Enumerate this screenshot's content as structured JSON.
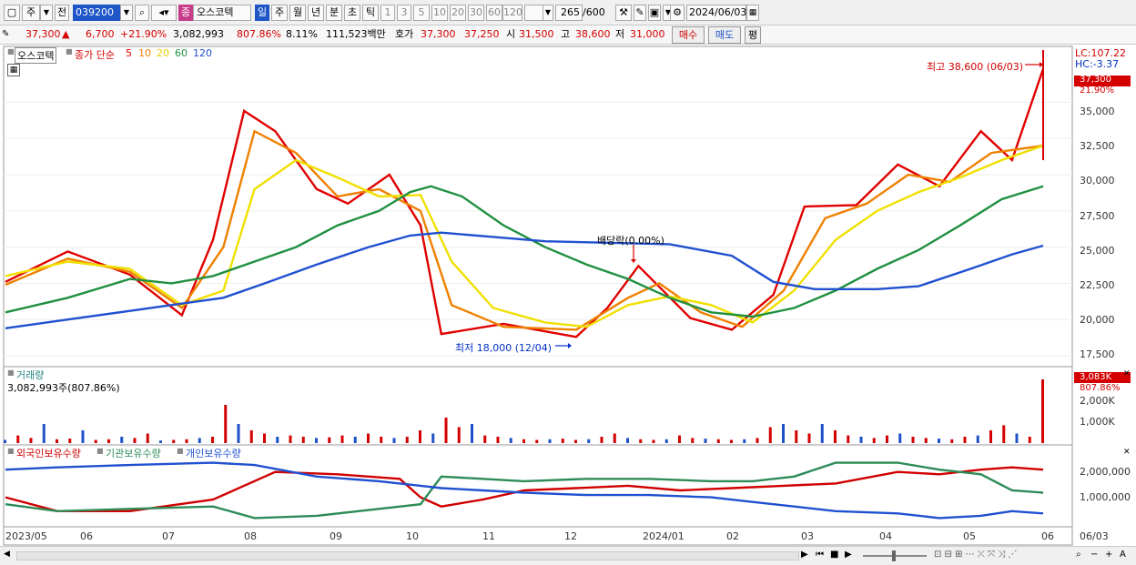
{
  "toolbar": {
    "period_main": "주",
    "prev_label": "전",
    "code": "039200",
    "stock_badge": "종",
    "stock_name": "오스코텍",
    "intervals": [
      "일",
      "주",
      "월",
      "년",
      "분",
      "초",
      "틱"
    ],
    "active_interval": "일",
    "minute_options": [
      "1",
      "3",
      "5",
      "10",
      "20",
      "30",
      "60",
      "120"
    ],
    "count": "265",
    "count_max": "/600",
    "date": "2024/06/03"
  },
  "quote": {
    "price": "37,300",
    "change_arrow": "▲",
    "change": "6,700",
    "change_pct": "+21.90%",
    "volume": "3,082,993",
    "volume_ratio": "807.86%",
    "turnover": "8.11%",
    "amount": "111,523백만",
    "ask_label": "호가",
    "ask": "37,300",
    "bid": "37,250",
    "open_label": "시",
    "open": "31,500",
    "high_label": "고",
    "high": "38,600",
    "low_label": "저",
    "low": "31,000",
    "buy_label": "매수",
    "sell_label": "매도",
    "eval_label": "평"
  },
  "price_panel": {
    "name_tab": "오스코텍",
    "legend_prefix": "종가 단순",
    "ma": [
      {
        "label": "5",
        "color": "#e00000"
      },
      {
        "label": "10",
        "color": "#f08000"
      },
      {
        "label": "20",
        "color": "#f0e000"
      },
      {
        "label": "60",
        "color": "#209040"
      },
      {
        "label": "120",
        "color": "#2050d0"
      }
    ],
    "lc": "LC:107.22",
    "hc": "HC:-3.37",
    "last_price": "37,300",
    "last_pct": "21.90%",
    "high_annotation": "최고 38,600 (06/03)",
    "low_annotation": "최저 18,000 (12/04)",
    "dividend_annotation": "배당락(0.00%)",
    "yticks": [
      "35,000",
      "32,500",
      "30,000",
      "27,500",
      "25,000",
      "22,500",
      "20,000",
      "17,500"
    ]
  },
  "volume_panel": {
    "title": "거래량",
    "summary": "3,082,993주(807.86%)",
    "last_value": "3,083K",
    "last_pct": "807.86%",
    "yticks": [
      "2,000K",
      "1,000K"
    ]
  },
  "holdings_panel": {
    "legend": [
      {
        "label": "외국인보유수량",
        "color": "#d00000"
      },
      {
        "label": "기관보유수량",
        "color": "#2e8b57"
      },
      {
        "label": "개인보유수량",
        "color": "#2050d0"
      }
    ],
    "yticks": [
      "2,000,000",
      "1,000,000"
    ]
  },
  "xaxis": {
    "labels": [
      "2023/05",
      "06",
      "07",
      "08",
      "09",
      "10",
      "11",
      "12",
      "2024/01",
      "02",
      "03",
      "04",
      "05",
      "06"
    ],
    "right_label": "06/03"
  },
  "colors": {
    "up": "#d40000",
    "down": "#1e50c8",
    "accent": "#1e56c8"
  },
  "chart_data": {
    "type": "line",
    "title": "",
    "series": [
      {
        "name": "5",
        "color": "#e00000",
        "points": [
          [
            0,
            22600
          ],
          [
            0.06,
            24700
          ],
          [
            0.12,
            23100
          ],
          [
            0.17,
            20300
          ],
          [
            0.2,
            25500
          ],
          [
            0.23,
            34400
          ],
          [
            0.26,
            33000
          ],
          [
            0.3,
            29000
          ],
          [
            0.33,
            28000
          ],
          [
            0.37,
            30000
          ],
          [
            0.4,
            26500
          ],
          [
            0.42,
            19000
          ],
          [
            0.48,
            19700
          ],
          [
            0.55,
            18800
          ],
          [
            0.58,
            20800
          ],
          [
            0.61,
            23700
          ],
          [
            0.66,
            20100
          ],
          [
            0.7,
            19300
          ],
          [
            0.74,
            21700
          ],
          [
            0.77,
            27800
          ],
          [
            0.82,
            27900
          ],
          [
            0.86,
            30700
          ],
          [
            0.9,
            29200
          ],
          [
            0.94,
            33000
          ],
          [
            0.97,
            31000
          ],
          [
            1,
            37300
          ]
        ]
      },
      {
        "name": "10",
        "color": "#f08000",
        "points": [
          [
            0,
            22400
          ],
          [
            0.06,
            24200
          ],
          [
            0.12,
            23300
          ],
          [
            0.17,
            20800
          ],
          [
            0.21,
            25000
          ],
          [
            0.24,
            33000
          ],
          [
            0.28,
            31500
          ],
          [
            0.32,
            28500
          ],
          [
            0.36,
            29000
          ],
          [
            0.4,
            27500
          ],
          [
            0.43,
            21000
          ],
          [
            0.48,
            19500
          ],
          [
            0.55,
            19300
          ],
          [
            0.6,
            21500
          ],
          [
            0.63,
            22500
          ],
          [
            0.67,
            20500
          ],
          [
            0.71,
            19500
          ],
          [
            0.75,
            22000
          ],
          [
            0.79,
            27000
          ],
          [
            0.83,
            28000
          ],
          [
            0.87,
            30000
          ],
          [
            0.91,
            29500
          ],
          [
            0.95,
            31500
          ],
          [
            1,
            32000
          ]
        ]
      },
      {
        "name": "20",
        "color": "#f0e000",
        "points": [
          [
            0,
            23000
          ],
          [
            0.06,
            24000
          ],
          [
            0.12,
            23500
          ],
          [
            0.17,
            21000
          ],
          [
            0.21,
            22000
          ],
          [
            0.24,
            29000
          ],
          [
            0.28,
            31000
          ],
          [
            0.32,
            29800
          ],
          [
            0.36,
            28500
          ],
          [
            0.4,
            28600
          ],
          [
            0.43,
            24000
          ],
          [
            0.47,
            20800
          ],
          [
            0.52,
            19800
          ],
          [
            0.56,
            19500
          ],
          [
            0.6,
            21000
          ],
          [
            0.64,
            21600
          ],
          [
            0.68,
            21000
          ],
          [
            0.72,
            19800
          ],
          [
            0.76,
            22000
          ],
          [
            0.8,
            25500
          ],
          [
            0.84,
            27500
          ],
          [
            0.88,
            28800
          ],
          [
            0.92,
            29800
          ],
          [
            0.96,
            31000
          ],
          [
            1,
            32000
          ]
        ]
      },
      {
        "name": "60",
        "color": "#209040",
        "points": [
          [
            0,
            20500
          ],
          [
            0.06,
            21500
          ],
          [
            0.12,
            22800
          ],
          [
            0.16,
            22500
          ],
          [
            0.2,
            23000
          ],
          [
            0.24,
            24000
          ],
          [
            0.28,
            25000
          ],
          [
            0.32,
            26500
          ],
          [
            0.36,
            27500
          ],
          [
            0.39,
            28800
          ],
          [
            0.41,
            29200
          ],
          [
            0.44,
            28500
          ],
          [
            0.48,
            26500
          ],
          [
            0.52,
            25000
          ],
          [
            0.56,
            23800
          ],
          [
            0.6,
            22800
          ],
          [
            0.64,
            21500
          ],
          [
            0.68,
            20500
          ],
          [
            0.72,
            20200
          ],
          [
            0.76,
            20800
          ],
          [
            0.8,
            22000
          ],
          [
            0.84,
            23500
          ],
          [
            0.88,
            24800
          ],
          [
            0.92,
            26500
          ],
          [
            0.96,
            28300
          ],
          [
            1,
            29200
          ]
        ]
      },
      {
        "name": "120",
        "color": "#2050d0",
        "points": [
          [
            0,
            19400
          ],
          [
            0.06,
            20000
          ],
          [
            0.12,
            20600
          ],
          [
            0.17,
            21100
          ],
          [
            0.21,
            21500
          ],
          [
            0.25,
            22500
          ],
          [
            0.3,
            23800
          ],
          [
            0.35,
            25000
          ],
          [
            0.39,
            25800
          ],
          [
            0.42,
            26000
          ],
          [
            0.47,
            25700
          ],
          [
            0.52,
            25400
          ],
          [
            0.58,
            25300
          ],
          [
            0.64,
            25200
          ],
          [
            0.7,
            24400
          ],
          [
            0.74,
            22600
          ],
          [
            0.78,
            22100
          ],
          [
            0.84,
            22100
          ],
          [
            0.88,
            22300
          ],
          [
            0.93,
            23500
          ],
          [
            0.97,
            24500
          ],
          [
            1,
            25100
          ]
        ]
      }
    ],
    "volume": [
      0.05,
      0.12,
      0.08,
      0.3,
      0.06,
      0.07,
      0.2,
      0.05,
      0.06,
      0.1,
      0.08,
      0.15,
      0.04,
      0.05,
      0.06,
      0.08,
      0.1,
      0.6,
      0.3,
      0.2,
      0.15,
      0.1,
      0.12,
      0.1,
      0.08,
      0.09,
      0.12,
      0.1,
      0.15,
      0.1,
      0.08,
      0.1,
      0.2,
      0.15,
      0.4,
      0.25,
      0.3,
      0.12,
      0.1,
      0.08,
      0.06,
      0.05,
      0.06,
      0.07,
      0.05,
      0.06,
      0.1,
      0.15,
      0.08,
      0.06,
      0.05,
      0.06,
      0.12,
      0.08,
      0.07,
      0.06,
      0.05,
      0.06,
      0.08,
      0.25,
      0.3,
      0.2,
      0.15,
      0.3,
      0.2,
      0.12,
      0.1,
      0.08,
      0.12,
      0.15,
      0.1,
      0.08,
      0.07,
      0.06,
      0.1,
      0.12,
      0.2,
      0.28,
      0.15,
      0.1,
      1.0
    ],
    "holdings": {
      "foreign": [
        [
          0,
          1500000
        ],
        [
          0.05,
          1200000
        ],
        [
          0.12,
          1200000
        ],
        [
          0.2,
          1450000
        ],
        [
          0.26,
          2050000
        ],
        [
          0.32,
          2000000
        ],
        [
          0.38,
          1900000
        ],
        [
          0.4,
          1500000
        ],
        [
          0.42,
          1300000
        ],
        [
          0.46,
          1450000
        ],
        [
          0.5,
          1650000
        ],
        [
          0.55,
          1700000
        ],
        [
          0.6,
          1750000
        ],
        [
          0.65,
          1650000
        ],
        [
          0.7,
          1700000
        ],
        [
          0.75,
          1750000
        ],
        [
          0.8,
          1800000
        ],
        [
          0.86,
          2050000
        ],
        [
          0.9,
          2000000
        ],
        [
          0.94,
          2100000
        ],
        [
          0.97,
          2150000
        ],
        [
          1,
          2100000
        ]
      ],
      "institution": [
        [
          0,
          1350000
        ],
        [
          0.05,
          1200000
        ],
        [
          0.12,
          1250000
        ],
        [
          0.2,
          1300000
        ],
        [
          0.24,
          1050000
        ],
        [
          0.3,
          1100000
        ],
        [
          0.36,
          1250000
        ],
        [
          0.4,
          1350000
        ],
        [
          0.42,
          1950000
        ],
        [
          0.46,
          1900000
        ],
        [
          0.5,
          1850000
        ],
        [
          0.56,
          1900000
        ],
        [
          0.62,
          1900000
        ],
        [
          0.68,
          1850000
        ],
        [
          0.72,
          1850000
        ],
        [
          0.76,
          1950000
        ],
        [
          0.8,
          2250000
        ],
        [
          0.86,
          2250000
        ],
        [
          0.9,
          2100000
        ],
        [
          0.94,
          2000000
        ],
        [
          0.97,
          1650000
        ],
        [
          1,
          1600000
        ]
      ],
      "individual": [
        [
          0,
          2100000
        ],
        [
          0.05,
          2150000
        ],
        [
          0.12,
          2200000
        ],
        [
          0.2,
          2250000
        ],
        [
          0.24,
          2200000
        ],
        [
          0.3,
          1950000
        ],
        [
          0.36,
          1850000
        ],
        [
          0.4,
          1750000
        ],
        [
          0.42,
          1700000
        ],
        [
          0.46,
          1650000
        ],
        [
          0.5,
          1600000
        ],
        [
          0.56,
          1550000
        ],
        [
          0.62,
          1550000
        ],
        [
          0.68,
          1500000
        ],
        [
          0.72,
          1400000
        ],
        [
          0.76,
          1300000
        ],
        [
          0.8,
          1200000
        ],
        [
          0.86,
          1150000
        ],
        [
          0.9,
          1050000
        ],
        [
          0.94,
          1100000
        ],
        [
          0.97,
          1200000
        ],
        [
          1,
          1150000
        ]
      ]
    },
    "ylim": [
      17000,
      38600
    ]
  }
}
